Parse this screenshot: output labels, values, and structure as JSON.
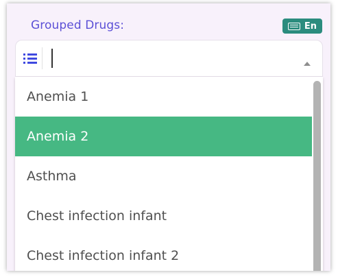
{
  "field": {
    "label": "Grouped Drugs:",
    "input_value": ""
  },
  "language_badge": {
    "label": "En",
    "icon": "keyboard-icon",
    "color": "#2b8c7e"
  },
  "select": {
    "list_icon": "list-icon",
    "arrow_icon": "caret-up-icon",
    "accent_color": "#3f49e0"
  },
  "dropdown": {
    "selected_color": "#46b883",
    "options": [
      {
        "label": "Anemia 1",
        "selected": false
      },
      {
        "label": "Anemia 2",
        "selected": true
      },
      {
        "label": "Asthma",
        "selected": false
      },
      {
        "label": "Chest infection infant",
        "selected": false
      },
      {
        "label": "Chest infection infant 2",
        "selected": false
      }
    ]
  }
}
